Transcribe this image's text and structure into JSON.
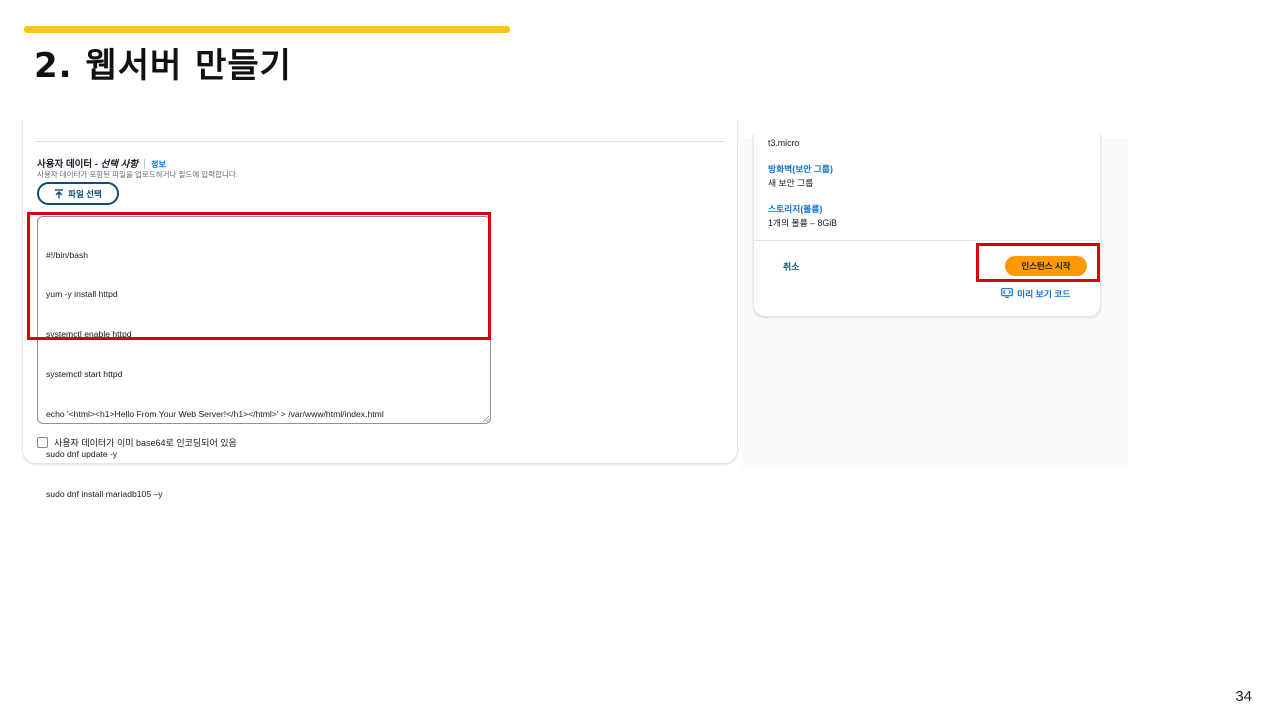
{
  "slide": {
    "title": "2. 웹서버 만들기",
    "page_number": "34",
    "accent_color": "#f5c518"
  },
  "user_data": {
    "title": "사용자 데이터 - ",
    "optional": "선택 사항",
    "info_link": "정보",
    "description": "사용자 데이터가 포함된 파일을 업로드하거나 필드에 입력합니다.",
    "file_button_label": "파일 선택",
    "file_button_icon": "upload-icon",
    "code_lines": [
      "#!/bin/bash",
      "yum -y install httpd",
      "systemctl enable httpd",
      "systemctl start httpd",
      "echo '<html><h1>Hello From Your Web Server!</h1></html>' > /var/www/html/index.html",
      "sudo dnf update -y",
      "sudo dnf install mariadb105 –y"
    ],
    "checkbox_label": "사용자 데이터가 이미 base64로 인코딩되어 있음",
    "checkbox_checked": false
  },
  "summary": {
    "instance_type_value": "t3.micro",
    "firewall_link": "방화벽(보안 그룹)",
    "firewall_value": "새 보안 그룹",
    "storage_link": "스토리지(볼륨)",
    "storage_value": "1개의 볼륨 – 8GiB",
    "cancel_label": "취소",
    "launch_label": "인스턴스 시작",
    "launch_color": "#ff9900",
    "preview_label": "미리 보기 코드",
    "preview_icon": "code-preview-icon"
  },
  "annotation_color": "#d6000f"
}
